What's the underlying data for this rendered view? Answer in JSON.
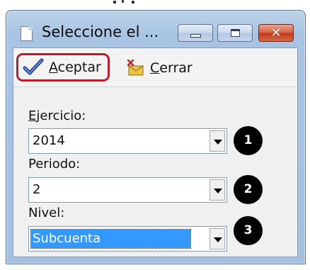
{
  "window": {
    "title": "Seleccione el ...",
    "controls": {
      "minimize": "minimize-icon",
      "maximize": "maximize-icon",
      "close": "close-icon",
      "close_glyph": "✕"
    }
  },
  "toolbar": {
    "accept": {
      "accel": "A",
      "rest": "ceptar",
      "icon": "checkmark-icon"
    },
    "close": {
      "accel": "C",
      "rest": "errar",
      "icon": "close-window-icon"
    }
  },
  "fields": [
    {
      "label_accel": "E",
      "label_rest": "jercicio:",
      "value": "2014",
      "selected": false,
      "badge": "1"
    },
    {
      "label_accel": "",
      "label_rest": "Periodo:",
      "value": "2",
      "selected": false,
      "badge": "2"
    },
    {
      "label_accel": "",
      "label_rest": "Nivel:",
      "value": "Subcuenta",
      "selected": true,
      "badge": "3"
    }
  ],
  "colors": {
    "accept_highlight": "#b51f2e",
    "selection": "#3399ff",
    "badge": "#000000"
  }
}
